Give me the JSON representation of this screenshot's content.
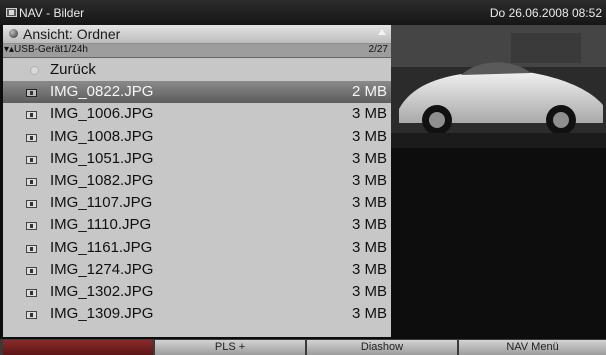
{
  "header": {
    "title": "NAV - Bilder",
    "datetime": "Do 26.06.2008  08:52"
  },
  "panel": {
    "view_label": "Ansicht: Ordner",
    "path": "USB-Gerät1/24h",
    "position": "2/27",
    "back_label": "Zurück",
    "files": [
      {
        "name": "IMG_0822.JPG",
        "size": "2 MB"
      },
      {
        "name": "IMG_1006.JPG",
        "size": "3 MB"
      },
      {
        "name": "IMG_1008.JPG",
        "size": "3 MB"
      },
      {
        "name": "IMG_1051.JPG",
        "size": "3 MB"
      },
      {
        "name": "IMG_1082.JPG",
        "size": "3 MB"
      },
      {
        "name": "IMG_1107.JPG",
        "size": "3 MB"
      },
      {
        "name": "IMG_1110.JPG",
        "size": "3 MB"
      },
      {
        "name": "IMG_1161.JPG",
        "size": "3 MB"
      },
      {
        "name": "IMG_1274.JPG",
        "size": "3 MB"
      },
      {
        "name": "IMG_1302.JPG",
        "size": "3 MB"
      },
      {
        "name": "IMG_1309.JPG",
        "size": "3 MB"
      }
    ],
    "selected_index": 0
  },
  "preview": {
    "subject": "white sports car photo thumbnail"
  },
  "footer": {
    "red_label": "",
    "green_label": "PLS +",
    "yellow_label": "Diashow",
    "blue_label": "NAV Menü"
  },
  "icons": {
    "app": "picture-icon",
    "file": "image-file-icon",
    "back": "back-dot-icon"
  }
}
